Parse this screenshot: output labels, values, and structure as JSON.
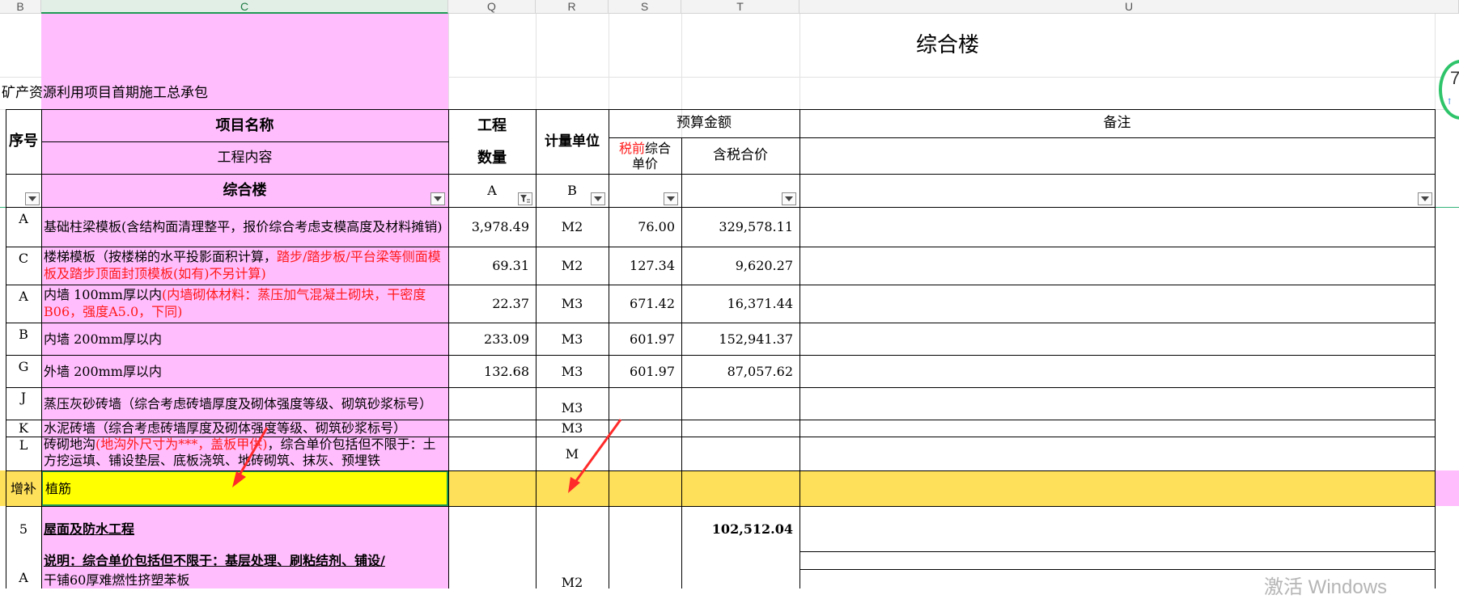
{
  "columns": [
    "B",
    "C",
    "Q",
    "R",
    "S",
    "T",
    "U"
  ],
  "sheet": {
    "title": "综合楼",
    "project_name": "矿产资源利用项目首期施工总承包"
  },
  "headers": {
    "seq": "序号",
    "item_name": "项目名称",
    "work_content": "工程内容",
    "qty_top": "工程",
    "qty_bottom": "数量",
    "unit": "计量单位",
    "budget": "预算金额",
    "pretax_red": "税前",
    "pretax_rest": "综合",
    "pretax_line2": "单价",
    "tax_total": "含税合价",
    "remarks": "备注",
    "subtitle": "综合楼",
    "filter_a": "A",
    "filter_b": "B"
  },
  "rows": [
    {
      "seq": "A",
      "name_black": "基础柱梁模板(含结构面清理整平，报价综合考虑支模高度及材料摊销)",
      "name_red": "",
      "qty": "3,978.49",
      "unit": "M2",
      "price": "76.00",
      "total": "329,578.11"
    },
    {
      "seq": "C",
      "name_black": "楼梯模板（按楼梯的水平投影面积计算，",
      "name_red": "踏步/踏步板/平台梁等侧面模板及踏步顶面封顶模板(如有)不另计算)",
      "qty": "69.31",
      "unit": "M2",
      "price": "127.34",
      "total": "9,620.27"
    },
    {
      "seq": "A",
      "name_black": "内墙 100mm厚以内",
      "name_red": "(内墙砌体材料：蒸压加气混凝土砌块，干密度B06，强度A5.0，下同)",
      "qty": "22.37",
      "unit": "M3",
      "price": "671.42",
      "total": "16,371.44"
    },
    {
      "seq": "B",
      "name_black": "内墙 200mm厚以内",
      "name_red": "",
      "qty": "233.09",
      "unit": "M3",
      "price": "601.97",
      "total": "152,941.37"
    },
    {
      "seq": "G",
      "name_black": "外墙 200mm厚以内",
      "name_red": "",
      "qty": "132.68",
      "unit": "M3",
      "price": "601.97",
      "total": "87,057.62"
    },
    {
      "seq": "J",
      "name_black": "蒸压灰砂砖墙（综合考虑砖墙厚度及砌体强度等级、砌筑砂浆标号）",
      "name_red": "",
      "qty": "",
      "unit": "M3",
      "price": "",
      "total": ""
    },
    {
      "seq": "K",
      "name_black": "水泥砖墙（综合考虑砖墙厚度及砌体强度等级、砌筑砂浆标号）",
      "name_red": "",
      "qty": "",
      "unit": "M3",
      "price": "",
      "total": ""
    },
    {
      "seq": "L",
      "name_black": "砖砌地沟",
      "name_red": "(地沟外尺寸为***，盖板甲供)",
      "name_black2": "，综合单价包括但不限于：土方挖运填、铺设垫层、底板浇筑、地砖砌筑、抹灰、预埋铁",
      "qty": "",
      "unit": "M",
      "price": "",
      "total": ""
    },
    {
      "seq": "增补",
      "name_black": "植筋",
      "name_red": "",
      "qty": "",
      "unit": "",
      "price": "",
      "total": ""
    },
    {
      "seq": "5",
      "name_black": "屋面及防水工程",
      "name_red": "",
      "qty": "",
      "unit": "",
      "price": "",
      "total": "102,512.04"
    },
    {
      "seq": "",
      "name_black": "说明：综合单价包括但不限于：基层处理、刷粘结剂、铺设/",
      "name_red": "",
      "qty": "",
      "unit": "",
      "price": "",
      "total": ""
    },
    {
      "seq": "A",
      "name_black": "干铺60厚难燃性挤塑苯板",
      "name_red": "",
      "qty": "",
      "unit": "M2",
      "price": "",
      "total": ""
    }
  ],
  "side_badge": "7",
  "watermark": "激活 Windows",
  "colors": {
    "pink": "#ffbdfd",
    "yellow": "#ffe05a",
    "highlight": "#ffff00",
    "red": "#ff1a1a",
    "selection": "#1f9a55"
  }
}
